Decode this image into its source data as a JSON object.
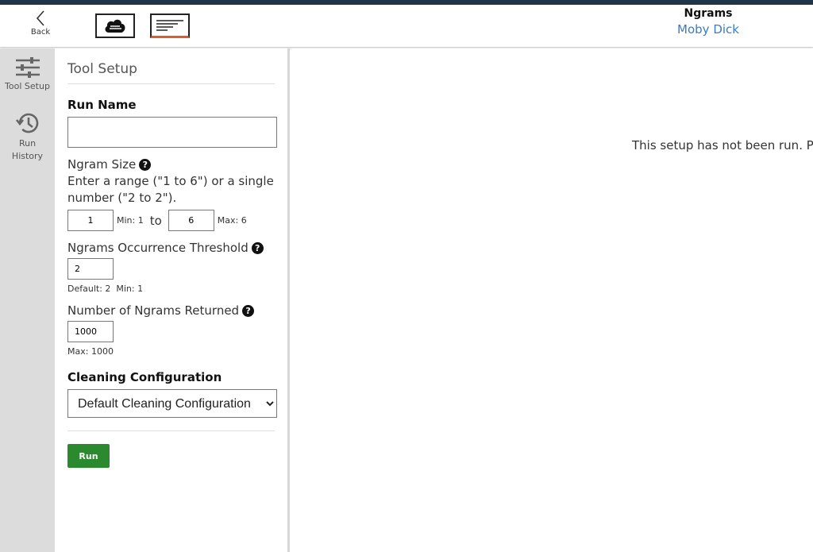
{
  "header": {
    "back_label": "Back",
    "tool_name": "Ngrams",
    "corpus_name": "Moby Dick",
    "views": [
      {
        "name": "cloud-view",
        "icon": "cloud-icon"
      },
      {
        "name": "list-view",
        "icon": "list-lines-icon",
        "active": true
      }
    ]
  },
  "sidebar": {
    "items": [
      {
        "label": "Tool Setup",
        "icon": "sliders-icon"
      },
      {
        "label_line1": "Run",
        "label_line2": "History",
        "icon": "history-icon"
      }
    ]
  },
  "setup": {
    "title": "Tool Setup",
    "run_name": {
      "label": "Run Name",
      "value": ""
    },
    "ngram_size": {
      "label": "Ngram Size",
      "help": "Enter a range (\"1 to 6\") or a single number (\"2 to 2\").",
      "min_value": "1",
      "min_note": "Min: 1",
      "to_label": "to",
      "max_value": "6",
      "max_note": "Max: 6"
    },
    "threshold": {
      "label": "Ngrams Occurrence Threshold",
      "value": "2",
      "note": "Default: 2  Min: 1"
    },
    "returned": {
      "label": "Number of Ngrams Returned",
      "value": "1000",
      "note": "Max: 1000"
    },
    "cleaning": {
      "label": "Cleaning Configuration",
      "selected": "Default Cleaning Configuration"
    },
    "run_button": "Run"
  },
  "results": {
    "message": "This setup has not been run. Ple"
  },
  "colors": {
    "accent": "#e05a2b",
    "run_button": "#2b8a2e",
    "link": "#3c7bbf",
    "rail": "#dcdcdc"
  }
}
